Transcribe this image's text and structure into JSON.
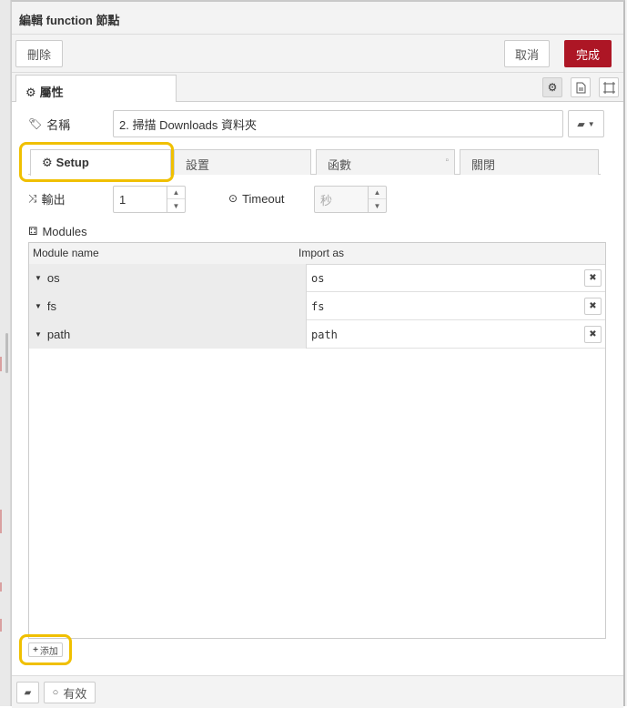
{
  "dialog": {
    "title": "編輯 function 節點"
  },
  "toolbar": {
    "delete_label": "刪除",
    "cancel_label": "取消",
    "done_label": "完成"
  },
  "tabs": {
    "properties_label": "屬性"
  },
  "form": {
    "name_label": "名稱",
    "name_value": "2. 掃描 Downloads 資料夾",
    "outputs_label": "輸出",
    "outputs_value": "1",
    "timeout_label": "Timeout",
    "timeout_placeholder": "秒",
    "modules_label": "Modules"
  },
  "subtabs": [
    {
      "label": "Setup"
    },
    {
      "label": "設置"
    },
    {
      "label": "函數"
    },
    {
      "label": "關閉"
    }
  ],
  "modules_table": {
    "header_name": "Module name",
    "header_import": "Import as",
    "rows": [
      {
        "name": "os",
        "import_as": "os"
      },
      {
        "name": "fs",
        "import_as": "fs"
      },
      {
        "name": "path",
        "import_as": "path"
      }
    ]
  },
  "add_label": "添加",
  "footer": {
    "enabled_label": "有效"
  },
  "colors": {
    "primary": "#ad1625",
    "highlight": "#f0c000"
  }
}
